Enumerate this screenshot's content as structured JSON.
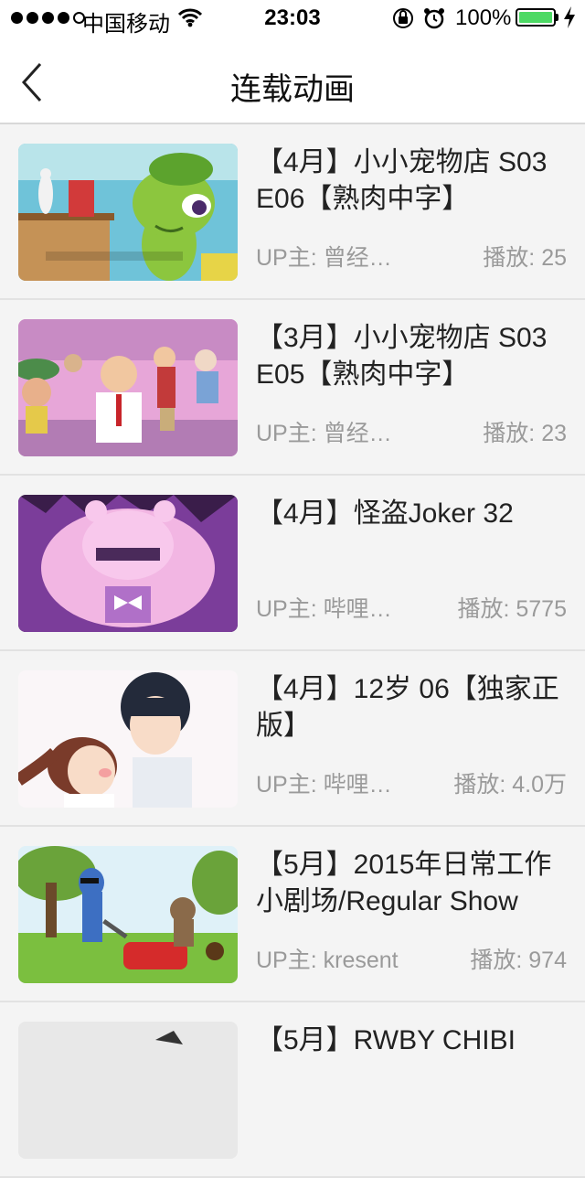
{
  "status_bar": {
    "carrier": "中国移动",
    "time": "23:03",
    "battery": "100%"
  },
  "nav": {
    "title": "连载动画"
  },
  "videos": [
    {
      "title": "【4月】小小宠物店 S03 E06【熟肉中字】",
      "uploader": "UP主: 曾经…",
      "plays": "播放: 25",
      "thumb": "green-lizard"
    },
    {
      "title": "【3月】小小宠物店 S03 E05【熟肉中字】",
      "uploader": "UP主: 曾经…",
      "plays": "播放: 23",
      "thumb": "office-crowd"
    },
    {
      "title": "【4月】怪盗Joker 32",
      "uploader": "UP主: 哔哩…",
      "plays": "播放: 5775",
      "thumb": "pink-hair-girl"
    },
    {
      "title": "【4月】12岁 06【独家正版】",
      "uploader": "UP主: 哔哩…",
      "plays": "播放: 4.0万",
      "thumb": "anime-couple"
    },
    {
      "title": "【5月】2015年日常工作小剧场/Regular Show",
      "uploader": "UP主: kresent",
      "plays": "播放: 974",
      "thumb": "bluejay-lawnmower"
    },
    {
      "title": "【5月】RWBY CHIBI",
      "uploader": "",
      "plays": "",
      "thumb": "partial"
    }
  ]
}
